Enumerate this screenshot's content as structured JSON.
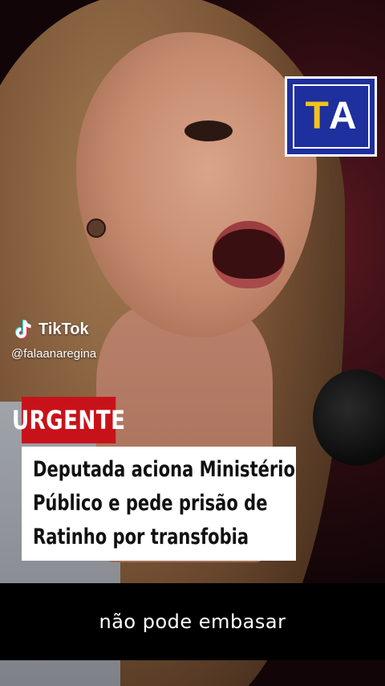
{
  "video": {
    "channel_logo": {
      "letter_1": "T",
      "letter_2": "A",
      "bg_color": "#1e2f9e",
      "accent_color": "#f3c21b"
    },
    "watermark": {
      "brand": "TikTok",
      "username": "@falaanaregina",
      "icon": "tiktok-note-icon"
    },
    "headline": {
      "tag": "URGENTE",
      "tag_color": "#c8121a",
      "lines": [
        "Deputada aciona Ministério",
        "Público e pede prisão de",
        "Ratinho por transfobia"
      ]
    },
    "subtitle": "não pode embasar"
  }
}
